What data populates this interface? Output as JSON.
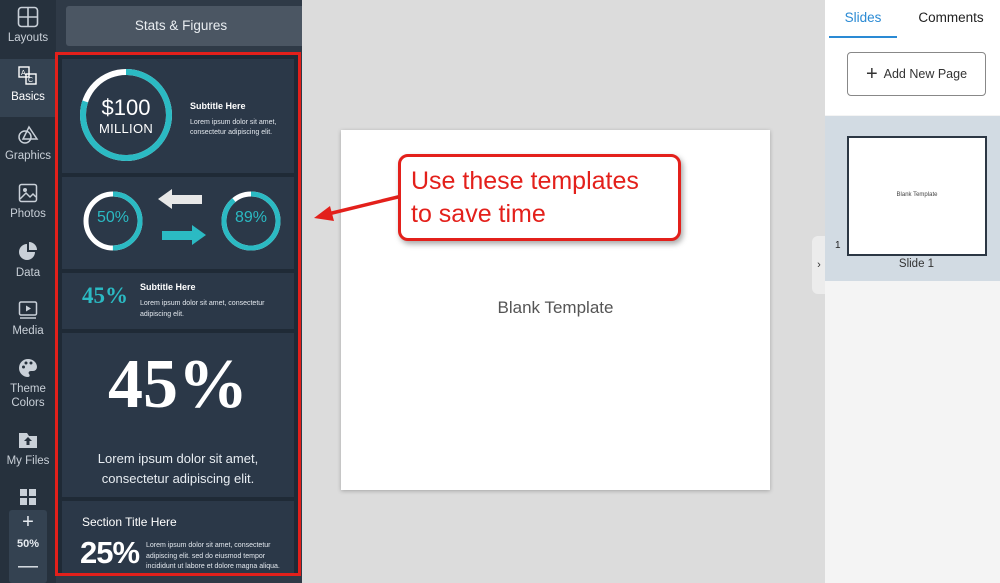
{
  "rail": {
    "items": [
      {
        "label": "Layouts",
        "icon": "layouts-icon"
      },
      {
        "label": "Basics",
        "icon": "basics-icon"
      },
      {
        "label": "Graphics",
        "icon": "graphics-icon"
      },
      {
        "label": "Photos",
        "icon": "photos-icon"
      },
      {
        "label": "Data",
        "icon": "data-icon"
      },
      {
        "label": "Media",
        "icon": "media-icon"
      },
      {
        "label": "Theme Colors",
        "icon": "palette-icon"
      },
      {
        "label": "My Files",
        "icon": "upload-icon"
      }
    ],
    "zoom": {
      "plus": "+",
      "value": "50%",
      "minus": "—"
    }
  },
  "panel": {
    "title": "Stats & Figures",
    "close": "×",
    "templates": {
      "card1": {
        "amount": "$100",
        "unit": "MILLION",
        "subtitle": "Subtitle Here",
        "body": "Lorem ipsum dolor sit amet, consectetur adipiscing elit.",
        "ring_percent": 80
      },
      "card2": {
        "left_percent": "50%",
        "right_percent": "89%",
        "left_value": 50,
        "right_value": 89
      },
      "card3": {
        "big": "45%",
        "subtitle": "Subtitle Here",
        "body": "Lorem ipsum dolor sit amet, consectetur adipiscing elit."
      },
      "card4": {
        "big": "45%",
        "body": "Lorem ipsum dolor sit amet, consectetur adipiscing elit."
      },
      "card5": {
        "section_title": "Section Title Here",
        "big": "25%",
        "body": "Lorem ipsum dolor sit amet, consectetur adipiscing elit. sed do eiusmod tempor incididunt ut labore et dolore magna aliqua."
      }
    }
  },
  "canvas": {
    "slide_text": "Blank Template",
    "callout": {
      "line1": "Use these templates",
      "line2": "to save time"
    }
  },
  "right": {
    "tabs": {
      "slides": "Slides",
      "comments": "Comments"
    },
    "add_page": "Add New Page",
    "thumbnail": {
      "number": "1",
      "text": "Blank Template",
      "caption": "Slide 1"
    }
  },
  "colors": {
    "accent": "#2bbac3",
    "highlight": "#e3201b",
    "panel": "#2f3a47",
    "rail": "#26313d",
    "tab_active": "#2a8ad4"
  }
}
